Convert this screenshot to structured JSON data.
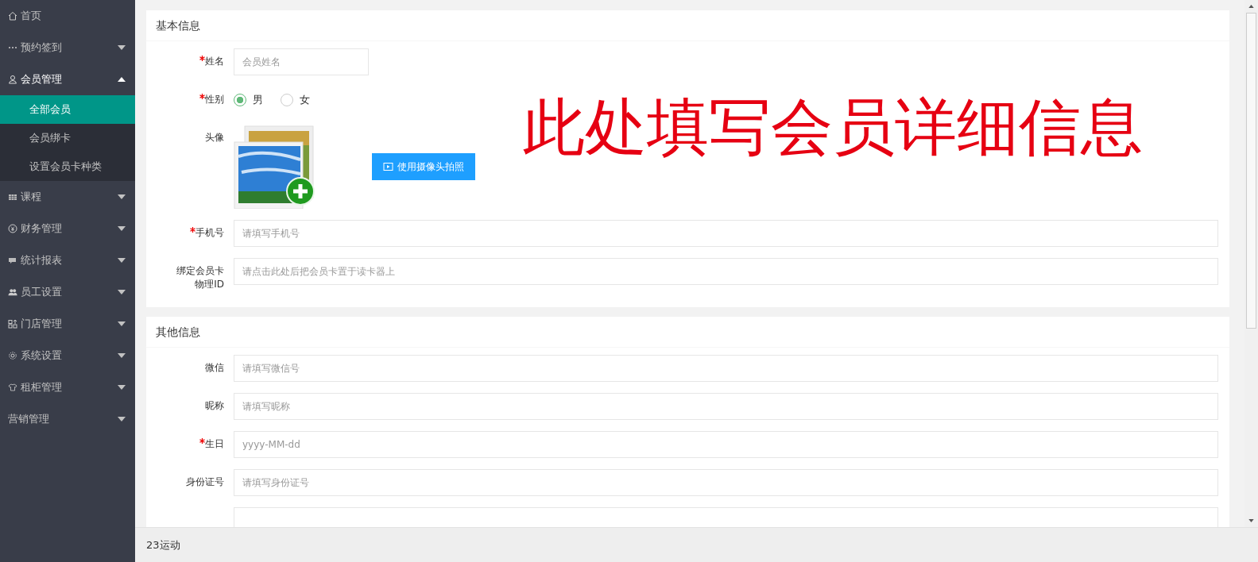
{
  "sidebar": {
    "items": [
      {
        "label": "首页",
        "has_caret": false,
        "expanded": false
      },
      {
        "label": "预约签到",
        "has_caret": true,
        "expanded": false
      },
      {
        "label": "会员管理",
        "has_caret": true,
        "expanded": true,
        "children": [
          {
            "label": "全部会员",
            "selected": true
          },
          {
            "label": "会员绑卡",
            "selected": false
          },
          {
            "label": "设置会员卡种类",
            "selected": false
          }
        ]
      },
      {
        "label": "课程",
        "has_caret": true,
        "expanded": false
      },
      {
        "label": "财务管理",
        "has_caret": true,
        "expanded": false
      },
      {
        "label": "统计报表",
        "has_caret": true,
        "expanded": false
      },
      {
        "label": "员工设置",
        "has_caret": true,
        "expanded": false
      },
      {
        "label": "门店管理",
        "has_caret": true,
        "expanded": false
      },
      {
        "label": "系统设置",
        "has_caret": true,
        "expanded": false
      },
      {
        "label": "租柜管理",
        "has_caret": true,
        "expanded": false
      },
      {
        "label": "营销管理",
        "has_caret": true,
        "expanded": false
      }
    ]
  },
  "annotation": "此处填写会员详细信息",
  "sections": [
    {
      "title": "基本信息",
      "fields": [
        {
          "kind": "text",
          "label": "姓名",
          "required": true,
          "placeholder": "会员姓名",
          "short": true
        },
        {
          "kind": "radio",
          "label": "性别",
          "required": true,
          "options": [
            {
              "label": "男",
              "selected": true
            },
            {
              "label": "女",
              "selected": false
            }
          ]
        },
        {
          "kind": "avatar",
          "label": "头像",
          "required": false,
          "button": "使用摄像头拍照"
        },
        {
          "kind": "text",
          "label": "手机号",
          "required": true,
          "placeholder": "请填写手机号"
        },
        {
          "kind": "text",
          "label": "绑定会员卡物理ID",
          "required": false,
          "placeholder": "请点击此处后把会员卡置于读卡器上"
        }
      ]
    },
    {
      "title": "其他信息",
      "fields": [
        {
          "kind": "text",
          "label": "微信",
          "required": false,
          "placeholder": "请填写微信号"
        },
        {
          "kind": "text",
          "label": "昵称",
          "required": false,
          "placeholder": "请填写昵称"
        },
        {
          "kind": "text",
          "label": "生日",
          "required": true,
          "placeholder": "yyyy-MM-dd"
        },
        {
          "kind": "text",
          "label": "身份证号",
          "required": false,
          "placeholder": "请填写身份证号"
        },
        {
          "kind": "text"
        }
      ]
    }
  ],
  "status_bar": {
    "text": "23运动"
  }
}
